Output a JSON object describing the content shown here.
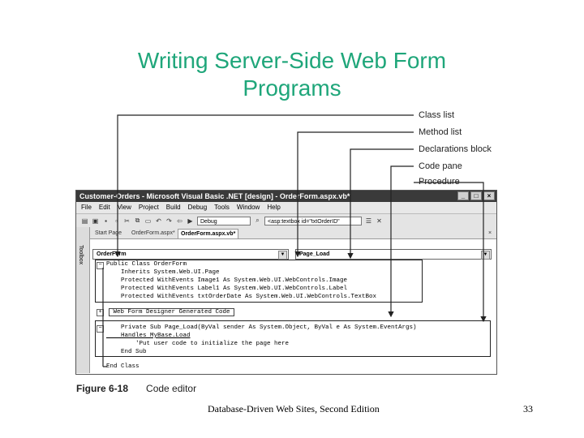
{
  "slide": {
    "title_line1": "Writing Server-Side Web Form",
    "title_line2": "Programs",
    "footer_left": "Database-Driven Web Sites, Second Edition",
    "page_number": "33"
  },
  "callouts": [
    "Class list",
    "Method list",
    "Declarations block",
    "Code pane",
    "Procedure"
  ],
  "figure": {
    "number": "Figure 6-18",
    "caption": "Code editor"
  },
  "window": {
    "title": "Customer-Orders - Microsoft Visual Basic .NET [design] - OrderForm.aspx.vb*",
    "menu": [
      "File",
      "Edit",
      "View",
      "Project",
      "Build",
      "Debug",
      "Tools",
      "Window",
      "Help"
    ],
    "config_select": "Debug",
    "object_select": "<asp:textbox id=\"txtOrderID\"",
    "tabs": [
      "Start Page",
      "OrderForm.aspx*",
      "OrderForm.aspx.vb*"
    ],
    "toolbox_label": "Toolbox",
    "class_list_value": "OrderForm",
    "method_list_value": "Page_Load",
    "close_x": "×"
  },
  "code_lines": [
    "Public Class OrderForm",
    "    Inherits System.Web.UI.Page",
    "    Protected WithEvents Image1 As System.Web.UI.WebControls.Image",
    "    Protected WithEvents Label1 As System.Web.UI.WebControls.Label",
    "    Protected WithEvents txtOrderDate As System.Web.UI.WebControls.TextBox",
    "",
    " Web Form Designer Generated Code ",
    "",
    "    Private Sub Page_Load(ByVal sender As System.Object, ByVal e As System.EventArgs)",
    "    Handles MyBase.Load",
    "        'Put user code to initialize the page here",
    "    End Sub",
    "",
    "End Class"
  ],
  "colors": {
    "title": "#1fa67a",
    "titlebar": "#3a3a3a"
  }
}
